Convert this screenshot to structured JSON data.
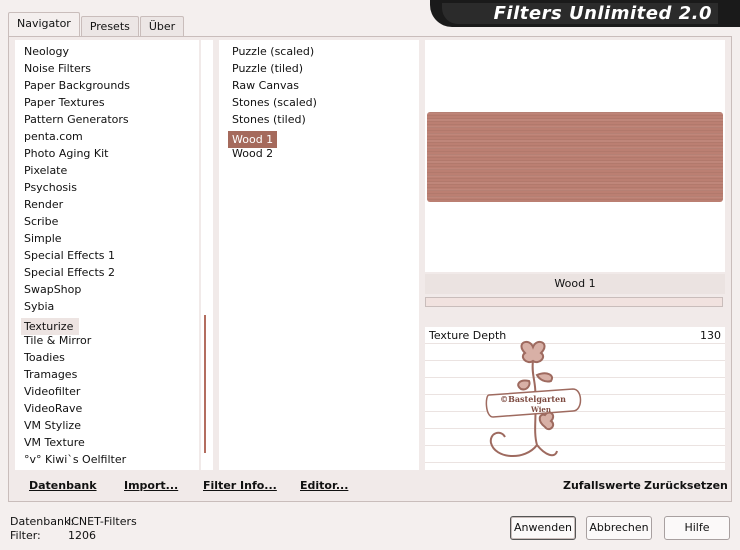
{
  "tabs": [
    {
      "label": "Navigator",
      "active": true
    },
    {
      "label": "Presets",
      "active": false
    },
    {
      "label": "Über",
      "active": false
    }
  ],
  "app_title": "Filters Unlimited 2.0",
  "categories": [
    "Neology",
    "Noise Filters",
    "Paper Backgrounds",
    "Paper Textures",
    "Pattern Generators",
    "penta.com",
    "Photo Aging Kit",
    "Pixelate",
    "Psychosis",
    "Render",
    "Scribe",
    "Simple",
    "Special Effects 1",
    "Special Effects 2",
    "SwapShop",
    "Sybia",
    "Texturize",
    "Tile & Mirror",
    "Toadies",
    "Tramages",
    "Videofilter",
    "VideoRave",
    "VM Stylize",
    "VM Texture",
    "°v° Kiwi`s Oelfilter"
  ],
  "selected_category": "Texturize",
  "filters": [
    "Puzzle (scaled)",
    "Puzzle (tiled)",
    "Raw Canvas",
    "Stones (scaled)",
    "Stones (tiled)",
    "Wood 1",
    "Wood 2"
  ],
  "selected_filter": "Wood 1",
  "preview": {
    "filter_name": "Wood 1",
    "texture_color": "#bb7f72"
  },
  "params": [
    {
      "label": "Texture Depth",
      "value": "130"
    }
  ],
  "watermark": {
    "line1": "©Bastelgarten",
    "line2": "Wien"
  },
  "footer_buttons": {
    "datenbank": "Datenbank",
    "import": "Import...",
    "filter_info": "Filter Info...",
    "editor": "Editor...",
    "zufallswerte": "Zufallswerte",
    "zuruecksetzen": "Zurücksetzen"
  },
  "status": {
    "db_label": "Datenbank:",
    "db_value": "ICNET-Filters",
    "filter_label": "Filter:",
    "filter_value": "1206"
  },
  "dialog_buttons": {
    "apply": "Anwenden",
    "cancel": "Abbrechen",
    "help": "Hilfe"
  },
  "colors": {
    "accent": "#a56a5c",
    "background": "#f4efee"
  }
}
